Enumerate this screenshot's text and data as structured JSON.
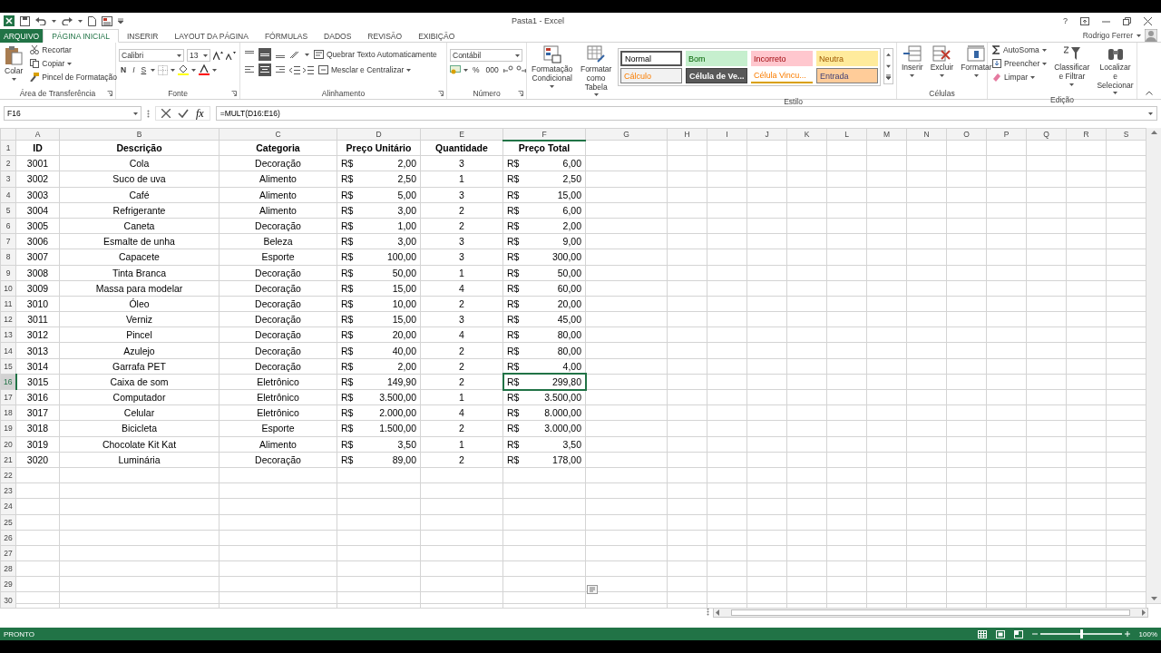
{
  "window": {
    "title": "Pasta1 - Excel",
    "help": "?",
    "user": "Rodrigo Ferrer"
  },
  "tabs": [
    {
      "label": "ARQUIVO",
      "kind": "file",
      "selected": false
    },
    {
      "label": "PÁGINA INICIAL",
      "kind": "tab",
      "selected": true
    },
    {
      "label": "INSERIR",
      "kind": "tab",
      "selected": false
    },
    {
      "label": "LAYOUT DA PÁGINA",
      "kind": "tab",
      "selected": false
    },
    {
      "label": "FÓRMULAS",
      "kind": "tab",
      "selected": false
    },
    {
      "label": "DADOS",
      "kind": "tab",
      "selected": false
    },
    {
      "label": "REVISÃO",
      "kind": "tab",
      "selected": false
    },
    {
      "label": "EXIBIÇÃO",
      "kind": "tab",
      "selected": false
    }
  ],
  "ribbon": {
    "clipboard": {
      "label": "Área de Transferência",
      "paste": "Colar",
      "cut": "Recortar",
      "copy": "Copiar",
      "painter": "Pincel de Formatação"
    },
    "font": {
      "label": "Fonte",
      "name": "Calibri",
      "size": "13",
      "bold": "N",
      "italic": "I",
      "underline": "S"
    },
    "alignment": {
      "label": "Alinhamento",
      "vertical": [
        {
          "selected": false
        },
        {
          "selected": true
        },
        {
          "selected": false
        }
      ],
      "horizontal": [
        {
          "selected": false
        },
        {
          "selected": true
        },
        {
          "selected": false
        }
      ],
      "wrap": "Quebrar Texto Automaticamente",
      "merge": "Mesclar e Centralizar"
    },
    "number": {
      "label": "Número",
      "format": "Contábil",
      "percent": "%",
      "thousands": "000"
    },
    "large_buttons": [
      "Formatação Condicional",
      "Formatar como Tabela"
    ],
    "styles": {
      "label": "Estilo",
      "items": [
        {
          "label": "Normal",
          "color": "#ffffff",
          "kind": "normal"
        },
        {
          "label": "Bom",
          "color": "#c6efce",
          "kind": "good"
        },
        {
          "label": "Incorreto",
          "color": "#ffc7ce",
          "kind": "bad"
        },
        {
          "label": "Neutra",
          "color": "#ffeb9c",
          "kind": "neutral"
        },
        {
          "label": "Cálculo",
          "color": "#f2f2f2",
          "kind": "calculation"
        },
        {
          "label": "Célula de Ve...",
          "color": "#595959",
          "kind": "check"
        },
        {
          "label": "Célula Vincu...",
          "color": "#ffffff",
          "kind": "linked"
        },
        {
          "label": "Entrada",
          "color": "#ffcc99",
          "kind": "input"
        }
      ]
    },
    "cells": {
      "label": "Células",
      "buttons": [
        "Inserir",
        "Excluir",
        "Formatar"
      ]
    },
    "editing": {
      "label": "Edição",
      "autosum": "AutoSoma",
      "fill": "Preencher",
      "clear": "Limpar",
      "sort": "Classificar e Filtrar",
      "find": "Localizar e Selecionar"
    }
  },
  "formula_bar": {
    "name_box": "F16",
    "function_label": "fx",
    "formula": "=MULT(D16:E16)"
  },
  "columns": [
    {
      "label": "A",
      "selected": false
    },
    {
      "label": "B",
      "selected": false
    },
    {
      "label": "C",
      "selected": false
    },
    {
      "label": "D",
      "selected": false
    },
    {
      "label": "E",
      "selected": false
    },
    {
      "label": "F",
      "selected": true
    },
    {
      "label": "G",
      "selected": false
    },
    {
      "label": "H",
      "selected": false
    },
    {
      "label": "I",
      "selected": false
    },
    {
      "label": "J",
      "selected": false
    },
    {
      "label": "K",
      "selected": false
    },
    {
      "label": "L",
      "selected": false
    },
    {
      "label": "M",
      "selected": false
    },
    {
      "label": "N",
      "selected": false
    },
    {
      "label": "O",
      "selected": false
    },
    {
      "label": "P",
      "selected": false
    },
    {
      "label": "Q",
      "selected": false
    },
    {
      "label": "R",
      "selected": false
    },
    {
      "label": "S",
      "selected": false
    }
  ],
  "header_row": {
    "number": "1",
    "headers": [
      "ID",
      "Descrição",
      "Categoria",
      "Preço Unitário",
      "Quantidade",
      "Preço Total"
    ]
  },
  "rows": [
    {
      "number": "2",
      "id": "3001",
      "description": "Cola",
      "category": "Decoração",
      "unit_currency": "R$",
      "unit_price": "2,00",
      "quantity": "3",
      "total_currency": "R$",
      "total": "6,00",
      "selected": false
    },
    {
      "number": "3",
      "id": "3002",
      "description": "Suco de uva",
      "category": "Alimento",
      "unit_currency": "R$",
      "unit_price": "2,50",
      "quantity": "1",
      "total_currency": "R$",
      "total": "2,50",
      "selected": false
    },
    {
      "number": "4",
      "id": "3003",
      "description": "Café",
      "category": "Alimento",
      "unit_currency": "R$",
      "unit_price": "5,00",
      "quantity": "3",
      "total_currency": "R$",
      "total": "15,00",
      "selected": false
    },
    {
      "number": "5",
      "id": "3004",
      "description": "Refrigerante",
      "category": "Alimento",
      "unit_currency": "R$",
      "unit_price": "3,00",
      "quantity": "2",
      "total_currency": "R$",
      "total": "6,00",
      "selected": false
    },
    {
      "number": "6",
      "id": "3005",
      "description": "Caneta",
      "category": "Decoração",
      "unit_currency": "R$",
      "unit_price": "1,00",
      "quantity": "2",
      "total_currency": "R$",
      "total": "2,00",
      "selected": false
    },
    {
      "number": "7",
      "id": "3006",
      "description": "Esmalte de unha",
      "category": "Beleza",
      "unit_currency": "R$",
      "unit_price": "3,00",
      "quantity": "3",
      "total_currency": "R$",
      "total": "9,00",
      "selected": false
    },
    {
      "number": "8",
      "id": "3007",
      "description": "Capacete",
      "category": "Esporte",
      "unit_currency": "R$",
      "unit_price": "100,00",
      "quantity": "3",
      "total_currency": "R$",
      "total": "300,00",
      "selected": false
    },
    {
      "number": "9",
      "id": "3008",
      "description": "Tinta Branca",
      "category": "Decoração",
      "unit_currency": "R$",
      "unit_price": "50,00",
      "quantity": "1",
      "total_currency": "R$",
      "total": "50,00",
      "selected": false
    },
    {
      "number": "10",
      "id": "3009",
      "description": "Massa para modelar",
      "category": "Decoração",
      "unit_currency": "R$",
      "unit_price": "15,00",
      "quantity": "4",
      "total_currency": "R$",
      "total": "60,00",
      "selected": false
    },
    {
      "number": "11",
      "id": "3010",
      "description": "Óleo",
      "category": "Decoração",
      "unit_currency": "R$",
      "unit_price": "10,00",
      "quantity": "2",
      "total_currency": "R$",
      "total": "20,00",
      "selected": false
    },
    {
      "number": "12",
      "id": "3011",
      "description": "Verniz",
      "category": "Decoração",
      "unit_currency": "R$",
      "unit_price": "15,00",
      "quantity": "3",
      "total_currency": "R$",
      "total": "45,00",
      "selected": false
    },
    {
      "number": "13",
      "id": "3012",
      "description": "Pincel",
      "category": "Decoração",
      "unit_currency": "R$",
      "unit_price": "20,00",
      "quantity": "4",
      "total_currency": "R$",
      "total": "80,00",
      "selected": false
    },
    {
      "number": "14",
      "id": "3013",
      "description": "Azulejo",
      "category": "Decoração",
      "unit_currency": "R$",
      "unit_price": "40,00",
      "quantity": "2",
      "total_currency": "R$",
      "total": "80,00",
      "selected": false
    },
    {
      "number": "15",
      "id": "3014",
      "description": "Garrafa PET",
      "category": "Decoração",
      "unit_currency": "R$",
      "unit_price": "2,00",
      "quantity": "2",
      "total_currency": "R$",
      "total": "4,00",
      "selected": false
    },
    {
      "number": "16",
      "id": "3015",
      "description": "Caixa de som",
      "category": "Eletrônico",
      "unit_currency": "R$",
      "unit_price": "149,90",
      "quantity": "2",
      "total_currency": "R$",
      "total": "299,80",
      "selected": true
    },
    {
      "number": "17",
      "id": "3016",
      "description": "Computador",
      "category": "Eletrônico",
      "unit_currency": "R$",
      "unit_price": "3.500,00",
      "quantity": "1",
      "total_currency": "R$",
      "total": "3.500,00",
      "selected": false
    },
    {
      "number": "18",
      "id": "3017",
      "description": "Celular",
      "category": "Eletrônico",
      "unit_currency": "R$",
      "unit_price": "2.000,00",
      "quantity": "4",
      "total_currency": "R$",
      "total": "8.000,00",
      "selected": false
    },
    {
      "number": "19",
      "id": "3018",
      "description": "Bicicleta",
      "category": "Esporte",
      "unit_currency": "R$",
      "unit_price": "1.500,00",
      "quantity": "2",
      "total_currency": "R$",
      "total": "3.000,00",
      "selected": false
    },
    {
      "number": "20",
      "id": "3019",
      "description": "Chocolate Kit Kat",
      "category": "Alimento",
      "unit_currency": "R$",
      "unit_price": "3,50",
      "quantity": "1",
      "total_currency": "R$",
      "total": "3,50",
      "selected": false
    },
    {
      "number": "21",
      "id": "3020",
      "description": "Luminária",
      "category": "Decoração",
      "unit_currency": "R$",
      "unit_price": "89,00",
      "quantity": "2",
      "total_currency": "R$",
      "total": "178,00",
      "selected": false
    }
  ],
  "empty_rows": [
    "22",
    "23",
    "24",
    "25",
    "26",
    "27",
    "28",
    "29",
    "30"
  ],
  "status_bar": {
    "status": "PRONTO",
    "zoom": "100%",
    "zoom_level": {
      "level": 0.5
    }
  }
}
